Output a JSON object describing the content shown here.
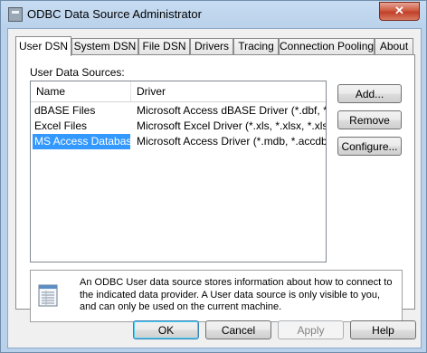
{
  "window": {
    "title": "ODBC Data Source Administrator",
    "close": "✕"
  },
  "tabs": [
    {
      "label": "User DSN",
      "active": true
    },
    {
      "label": "System DSN"
    },
    {
      "label": "File DSN"
    },
    {
      "label": "Drivers"
    },
    {
      "label": "Tracing"
    },
    {
      "label": "Connection Pooling"
    },
    {
      "label": "About"
    }
  ],
  "panel": {
    "section_label": "User Data Sources:",
    "columns": [
      "Name",
      "Driver"
    ],
    "rows": [
      {
        "name": "dBASE Files",
        "driver": "Microsoft Access dBASE Driver (*.dbf, *.ndx"
      },
      {
        "name": "Excel Files",
        "driver": "Microsoft Excel Driver (*.xls, *.xlsx, *.xlsm, *.x"
      },
      {
        "name": "MS Access Database",
        "driver": "Microsoft Access Driver (*.mdb, *.accdb)",
        "selected": true
      }
    ],
    "scroll_grip": "|||",
    "buttons": {
      "add": "Add...",
      "remove": "Remove",
      "configure": "Configure..."
    },
    "info_text": "An ODBC User data source stores information about how to connect to the indicated data provider.   A User data source is only visible to you, and can only be used on the current machine."
  },
  "footer": {
    "ok": "OK",
    "cancel": "Cancel",
    "apply": "Apply",
    "help": "Help"
  },
  "icons": {
    "app": "odbc-app-icon",
    "info": "database-document-icon"
  }
}
